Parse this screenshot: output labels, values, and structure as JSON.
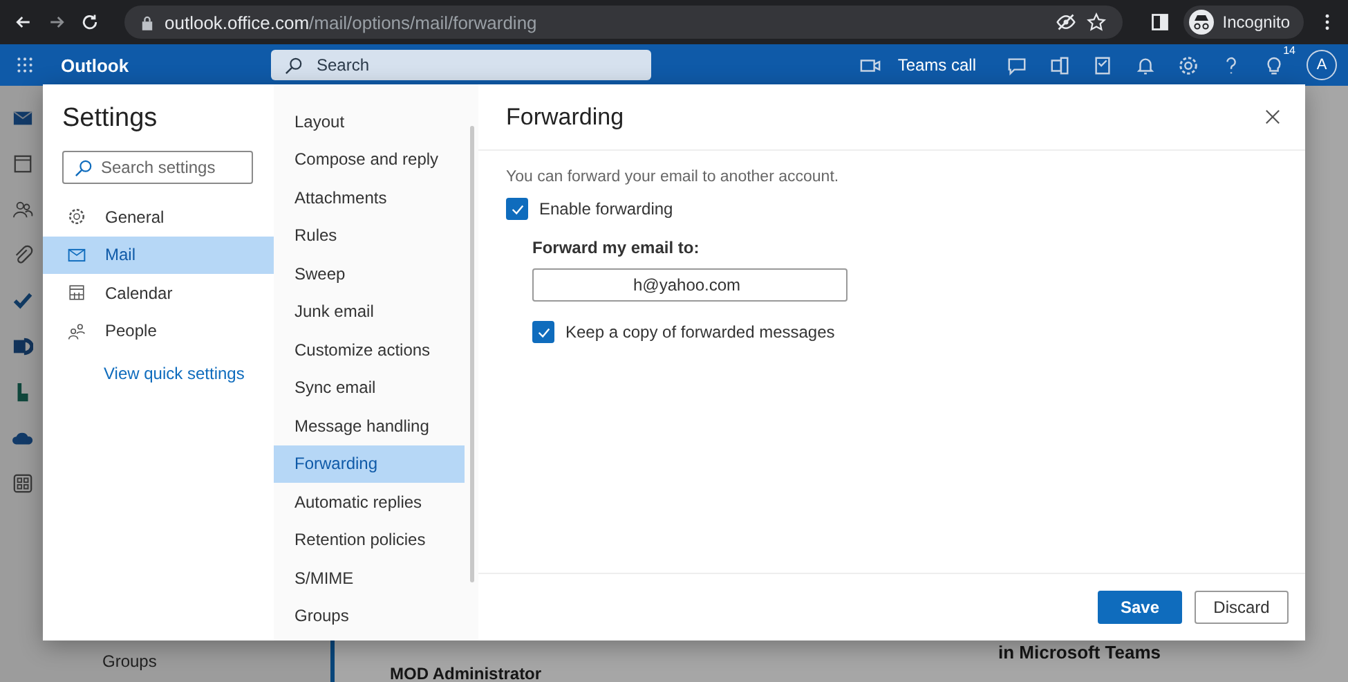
{
  "browser": {
    "url_host": "outlook.office.com",
    "url_path": "/mail/options/mail/forwarding",
    "profile_label": "Incognito"
  },
  "header": {
    "app_name": "Outlook",
    "search_placeholder": "Search",
    "teams_call": "Teams call",
    "tips_count": "14",
    "avatar_initial": "A"
  },
  "background": {
    "folder_label": "Groups",
    "sender": "MOD Administrator",
    "heading": "in Microsoft Teams"
  },
  "settings": {
    "title": "Settings",
    "search_placeholder": "Search settings",
    "categories": [
      {
        "kind": "gear",
        "label": "General",
        "selected": false
      },
      {
        "kind": "mail",
        "label": "Mail",
        "selected": true
      },
      {
        "kind": "calendar",
        "label": "Calendar",
        "selected": false
      },
      {
        "kind": "people",
        "label": "People",
        "selected": false
      }
    ],
    "quick_settings_link": "View quick settings",
    "subnav": [
      {
        "label": "Layout",
        "selected": false
      },
      {
        "label": "Compose and reply",
        "selected": false
      },
      {
        "label": "Attachments",
        "selected": false
      },
      {
        "label": "Rules",
        "selected": false
      },
      {
        "label": "Sweep",
        "selected": false
      },
      {
        "label": "Junk email",
        "selected": false
      },
      {
        "label": "Customize actions",
        "selected": false
      },
      {
        "label": "Sync email",
        "selected": false
      },
      {
        "label": "Message handling",
        "selected": false
      },
      {
        "label": "Forwarding",
        "selected": true
      },
      {
        "label": "Automatic replies",
        "selected": false
      },
      {
        "label": "Retention policies",
        "selected": false
      },
      {
        "label": "S/MIME",
        "selected": false
      },
      {
        "label": "Groups",
        "selected": false
      }
    ],
    "panel": {
      "title": "Forwarding",
      "intro": "You can forward your email to another account.",
      "enable_forwarding": {
        "label": "Enable forwarding",
        "checked": true
      },
      "forward_to_label": "Forward my email to:",
      "forward_to_value": "h@yahoo.com",
      "keep_copy": {
        "label": "Keep a copy of forwarded messages",
        "checked": true
      },
      "buttons": [
        {
          "kind": "primary",
          "label": "Save"
        },
        {
          "kind": "secondary",
          "label": "Discard"
        }
      ]
    }
  }
}
